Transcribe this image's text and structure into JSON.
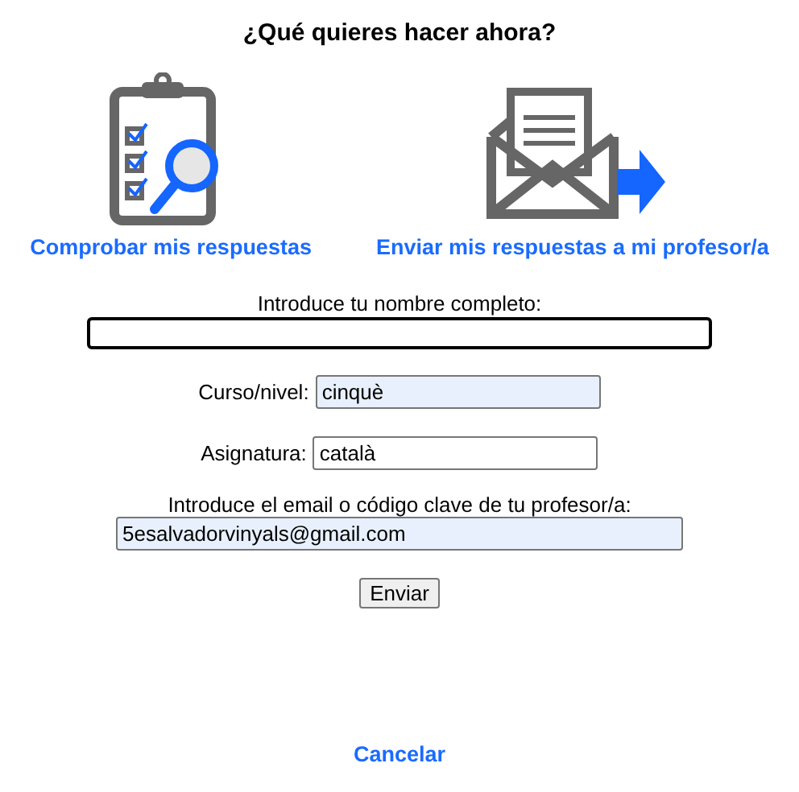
{
  "title": "¿Qué quieres hacer ahora?",
  "options": [
    {
      "kind": "check",
      "label": "Comprobar mis respuestas"
    },
    {
      "kind": "send",
      "label": "Enviar mis respuestas a mi profesor/a"
    }
  ],
  "name_field": {
    "label": "Introduce tu nombre completo:",
    "focused": true
  },
  "fields": [
    {
      "label": "Curso/nivel:",
      "value": "cinquè",
      "autofilled": true
    },
    {
      "label": "Asignatura:",
      "value": "català",
      "autofilled": false
    }
  ],
  "email_field": {
    "label": "Introduce el email o código clave de tu profesor/a:",
    "value": "5esalvadorvinyals@gmail.com",
    "autofilled": true
  },
  "submit": "Enviar",
  "cancel": "Cancelar"
}
